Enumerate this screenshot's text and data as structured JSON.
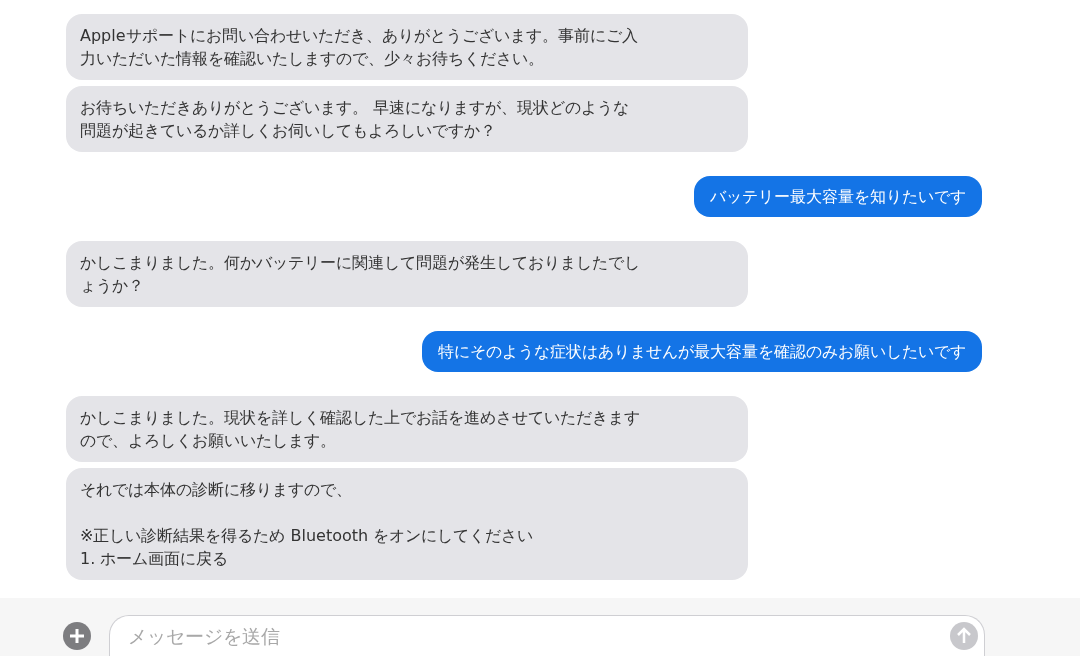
{
  "messages": [
    {
      "kind": "received",
      "text": "Appleサポートにお問い合わせいただき、ありがとうございます。事前にご入力いただいた情報を確認いたしますので、少々お待ちください。"
    },
    {
      "kind": "received",
      "text": "お待ちいただきありがとうございます。 早速になりますが、現状どのような問題が起きているか詳しくお伺いしてもよろしいですか？"
    },
    {
      "kind": "sent",
      "text": "バッテリー最大容量を知りたいです"
    },
    {
      "kind": "received",
      "text": "かしこまりました。何かバッテリーに関連して問題が発生しておりましたでしょうか？"
    },
    {
      "kind": "sent",
      "text": "特にそのような症状はありませんが最大容量を確認のみお願いしたいです"
    },
    {
      "kind": "received",
      "text": "かしこまりました。現状を詳しく確認した上でお話を進めさせていただきますので、よろしくお願いいたします。"
    },
    {
      "kind": "received",
      "text": "それでは本体の診断に移りますので、\n\n※正しい診断結果を得るため Bluetooth をオンにしてください\n1. ホーム画面に戻る"
    }
  ],
  "composer": {
    "placeholder": "メッセージを送信"
  }
}
